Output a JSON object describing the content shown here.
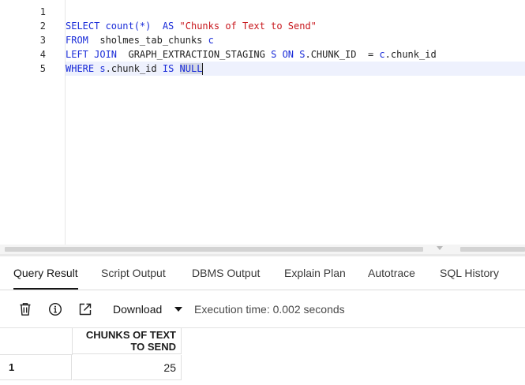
{
  "editor": {
    "line_numbers": [
      "1",
      "2",
      "3",
      "4",
      "5"
    ],
    "lines": [
      {
        "segments": []
      },
      {
        "segments": [
          {
            "t": "SELECT ",
            "c": "kw"
          },
          {
            "t": "count(*)",
            "c": "kw"
          },
          {
            "t": "  ",
            "c": "tb"
          },
          {
            "t": "AS ",
            "c": "kw"
          },
          {
            "t": "\"Chunks of Text to Send\"",
            "c": "str"
          }
        ]
      },
      {
        "segments": [
          {
            "t": "FROM  ",
            "c": "kw"
          },
          {
            "t": "sholmes_tab_chunks ",
            "c": "tb"
          },
          {
            "t": "c",
            "c": "kw"
          }
        ]
      },
      {
        "segments": [
          {
            "t": "LEFT JOIN  ",
            "c": "kw"
          },
          {
            "t": "GRAPH_EXTRACTION_STAGING ",
            "c": "tb"
          },
          {
            "t": "S ",
            "c": "kw"
          },
          {
            "t": "ON ",
            "c": "kw"
          },
          {
            "t": "S",
            "c": "kw"
          },
          {
            "t": ".CHUNK_ID  = ",
            "c": "tb"
          },
          {
            "t": "c",
            "c": "kw"
          },
          {
            "t": ".chunk_id",
            "c": "tb"
          }
        ]
      },
      {
        "segments": [
          {
            "t": "WHERE ",
            "c": "kw"
          },
          {
            "t": "s",
            "c": "kw"
          },
          {
            "t": ".chunk_id ",
            "c": "tb"
          },
          {
            "t": "IS ",
            "c": "kw"
          },
          {
            "t": "NULL",
            "c": "sel"
          }
        ]
      }
    ]
  },
  "tabs": [
    {
      "id": "query-result",
      "label": "Query Result",
      "active": true
    },
    {
      "id": "script-output",
      "label": "Script Output"
    },
    {
      "id": "dbms-output",
      "label": "DBMS Output"
    },
    {
      "id": "explain-plan",
      "label": "Explain Plan"
    },
    {
      "id": "autotrace",
      "label": "Autotrace"
    },
    {
      "id": "sql-history",
      "label": "SQL History"
    }
  ],
  "toolbar": {
    "delete_icon": "trash-icon",
    "info_icon": "info-icon",
    "open_icon": "open-external-icon",
    "download_label": "Download",
    "execution_time": "Execution time: 0.002 seconds"
  },
  "results": {
    "columns": [
      "CHUNKS OF TEXT TO SEND"
    ],
    "rows": [
      {
        "row_number": "1",
        "values": [
          "25"
        ]
      }
    ]
  },
  "colors": {
    "keyword": "#1a2cd8",
    "string": "#c8171d",
    "selection": "#d4d8e4",
    "active_line": "#eef1fd"
  }
}
